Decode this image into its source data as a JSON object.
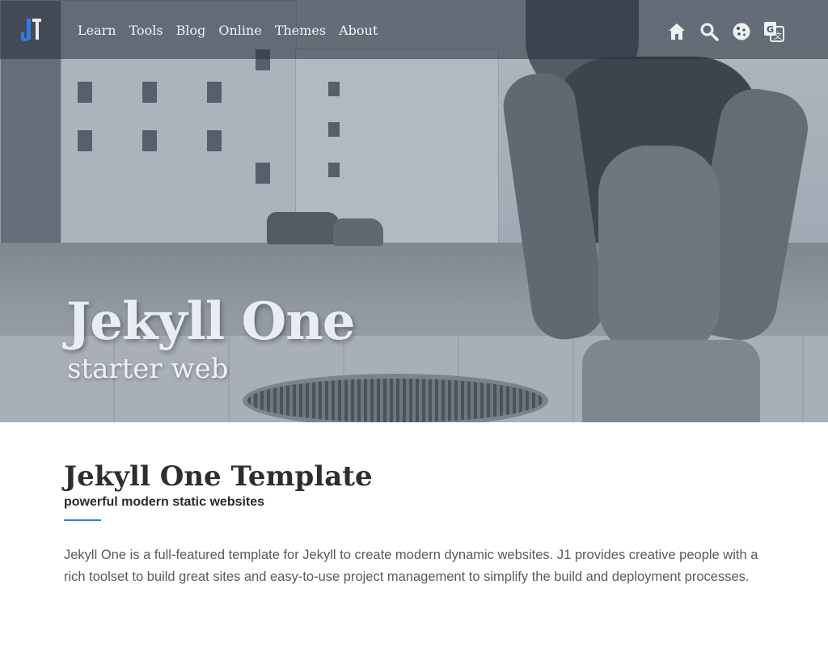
{
  "site": {
    "logo_text": "J1",
    "accent_color": "#2d7de0"
  },
  "nav": {
    "links": [
      "Learn",
      "Tools",
      "Blog",
      "Online",
      "Themes",
      "About"
    ],
    "icons": [
      "home-icon",
      "search-icon",
      "cookie-icon",
      "translate-icon"
    ]
  },
  "hero": {
    "title": "Jekyll One",
    "tagline": "starter web"
  },
  "content": {
    "title": "Jekyll One Template",
    "subtitle": "powerful modern static websites",
    "text": "Jekyll One is a full-featured template for Jekyll to create modern dynamic websites. J1 provides creative people with a rich toolset to build great sites and easy-to-use project management to simplify the build and deployment processes."
  }
}
